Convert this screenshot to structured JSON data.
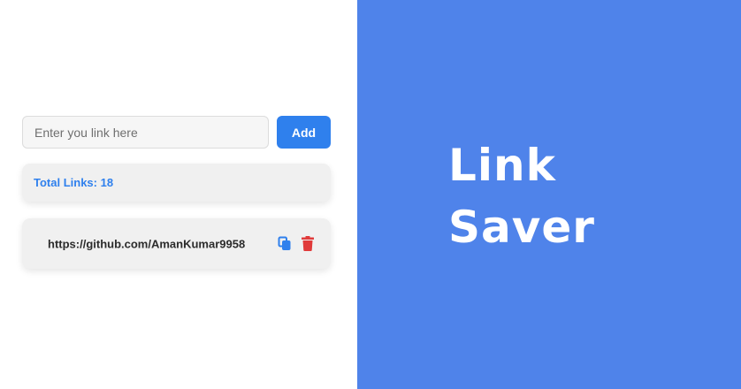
{
  "form": {
    "input_placeholder": "Enter you link here",
    "input_value": "",
    "add_label": "Add"
  },
  "summary": {
    "total_label": "Total Links: 18"
  },
  "links": [
    {
      "url": "https://github.com/AmanKumar9958",
      "copy_icon": "copy-icon",
      "delete_icon": "trash-icon"
    }
  ],
  "brand": {
    "line1": "Link",
    "line2": "Saver"
  },
  "colors": {
    "accent": "#2f80ed",
    "brand_panel": "#4f83ea",
    "delete": "#e03a3a"
  }
}
